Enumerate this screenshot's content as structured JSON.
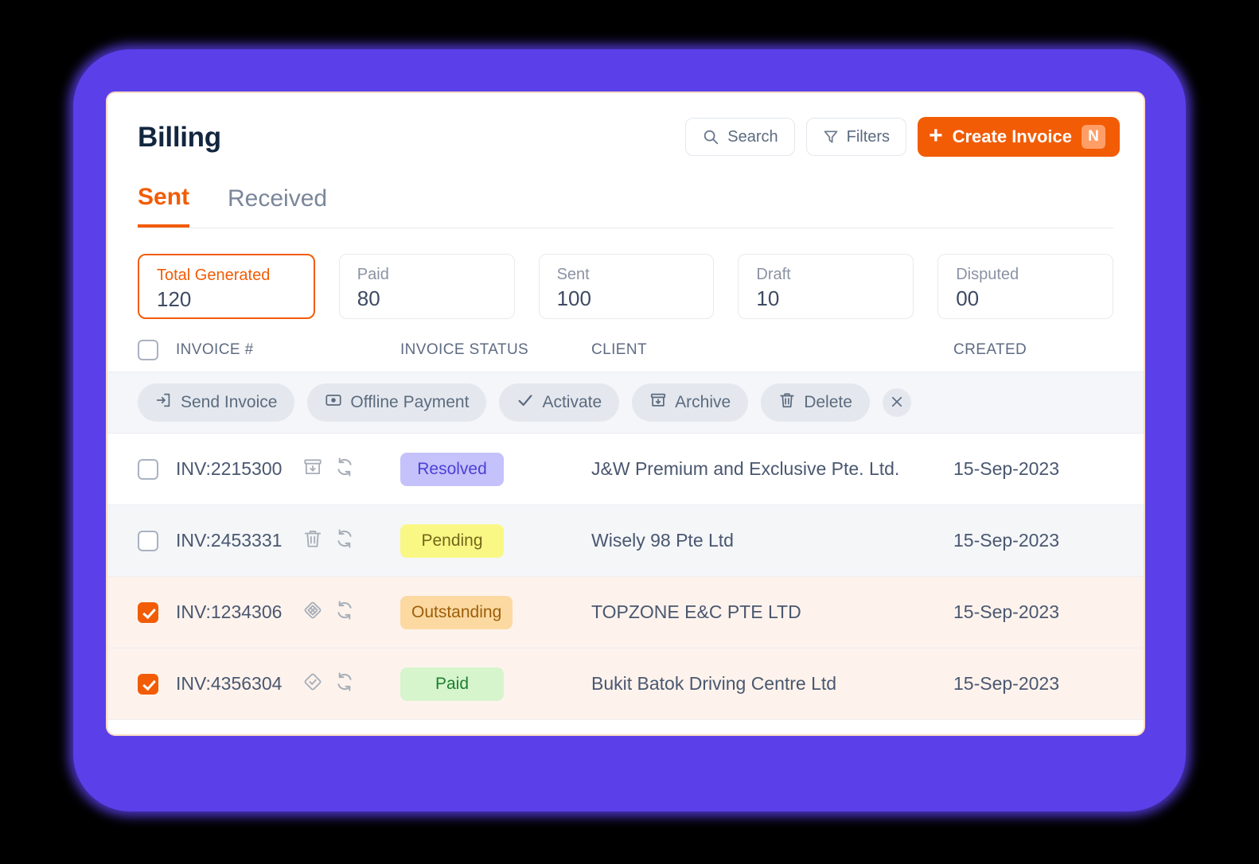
{
  "header": {
    "title": "Billing",
    "search_label": "Search",
    "filters_label": "Filters",
    "create_label": "Create Invoice",
    "create_shortcut": "N",
    "accent_color": "#F25C05"
  },
  "tabs": [
    {
      "label": "Sent",
      "active": true
    },
    {
      "label": "Received",
      "active": false
    }
  ],
  "stats": [
    {
      "label": "Total Generated",
      "value": "120",
      "highlight": true
    },
    {
      "label": "Paid",
      "value": "80",
      "highlight": false
    },
    {
      "label": "Sent",
      "value": "100",
      "highlight": false
    },
    {
      "label": "Draft",
      "value": "10",
      "highlight": false
    },
    {
      "label": "Disputed",
      "value": "00",
      "highlight": false
    }
  ],
  "table": {
    "columns": {
      "invoice": "INVOICE #",
      "status": "INVOICE STATUS",
      "client": "CLIENT",
      "created": "CREATED"
    },
    "select_all_checked": false
  },
  "bulk_actions": [
    {
      "label": "Send Invoice",
      "icon": "send-invoice-icon"
    },
    {
      "label": "Offline Payment",
      "icon": "offline-payment-icon"
    },
    {
      "label": "Activate",
      "icon": "check-icon"
    },
    {
      "label": "Archive",
      "icon": "archive-icon"
    },
    {
      "label": "Delete",
      "icon": "trash-icon"
    }
  ],
  "rows": [
    {
      "checked": false,
      "tone": "tone-white",
      "invoice": "INV:2215300",
      "action_icon": "archive-icon",
      "sync_icon": "refresh-icon",
      "status": "Resolved",
      "status_bg": "#C5C1FA",
      "status_fg": "#4C3FD6",
      "client": "J&W Premium and Exclusive Pte. Ltd.",
      "created": "15-Sep-2023"
    },
    {
      "checked": false,
      "tone": "tone-gray",
      "invoice": "INV:2453331",
      "action_icon": "trash-icon",
      "sync_icon": "refresh-icon",
      "status": "Pending",
      "status_bg": "#FAF884",
      "status_fg": "#73661B",
      "client": "Wisely 98 Pte Ltd",
      "created": "15-Sep-2023"
    },
    {
      "checked": true,
      "tone": "tone-peach",
      "invoice": "INV:1234306",
      "action_icon": "diamond-cross-icon",
      "sync_icon": "refresh-icon",
      "status": "Outstanding",
      "status_bg": "#FBD9A1",
      "status_fg": "#9C5E09",
      "client": "TOPZONE E&C PTE LTD",
      "created": "15-Sep-2023"
    },
    {
      "checked": true,
      "tone": "tone-peach",
      "invoice": "INV:4356304",
      "action_icon": "diamond-check-icon",
      "sync_icon": "refresh-icon",
      "status": "Paid",
      "status_bg": "#D6F5CD",
      "status_fg": "#1C7F2E",
      "client": "Bukit Batok Driving Centre Ltd",
      "created": "15-Sep-2023"
    }
  ]
}
